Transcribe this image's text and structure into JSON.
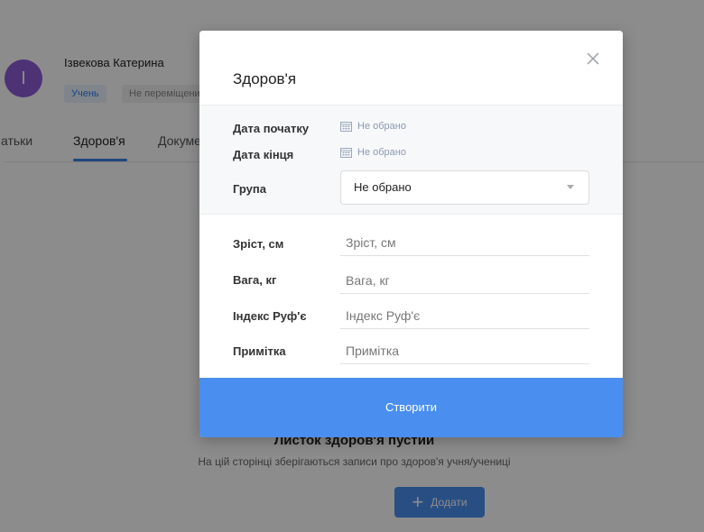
{
  "profile": {
    "avatar_letter": "І",
    "name": "Ізвекова Катерина",
    "role_badge": "Учень",
    "status_badge": "Не переміщени"
  },
  "tabs": [
    {
      "label": "атьки"
    },
    {
      "label": "Здоров'я"
    },
    {
      "label": "Докуме"
    }
  ],
  "empty_state": {
    "title": "Листок здоров'я пустий",
    "subtitle": "На цій сторінці зберігаються записи про здоров'я учня/учениці",
    "add_button": "Додати"
  },
  "modal": {
    "title": "Здоров'я",
    "start_date_label": "Дата початку",
    "start_date_value": "Не обрано",
    "end_date_label": "Дата кінця",
    "end_date_value": "Не обрано",
    "group_label": "Група",
    "group_value": "Не обрано",
    "height_label": "Зріст, см",
    "height_placeholder": "Зріст, см",
    "weight_label": "Вага, кг",
    "weight_placeholder": "Вага, кг",
    "ruffier_label": "Індекс Руф'є",
    "ruffier_placeholder": "Індекс Руф'є",
    "note_label": "Примітка",
    "note_placeholder": "Примітка",
    "create_button": "Створити"
  },
  "colors": {
    "accent": "#4a8ef0",
    "avatar": "#8e5bd8"
  },
  "icons": [
    "close-icon",
    "calendar-icon",
    "chevron-down-icon",
    "plus-icon"
  ]
}
